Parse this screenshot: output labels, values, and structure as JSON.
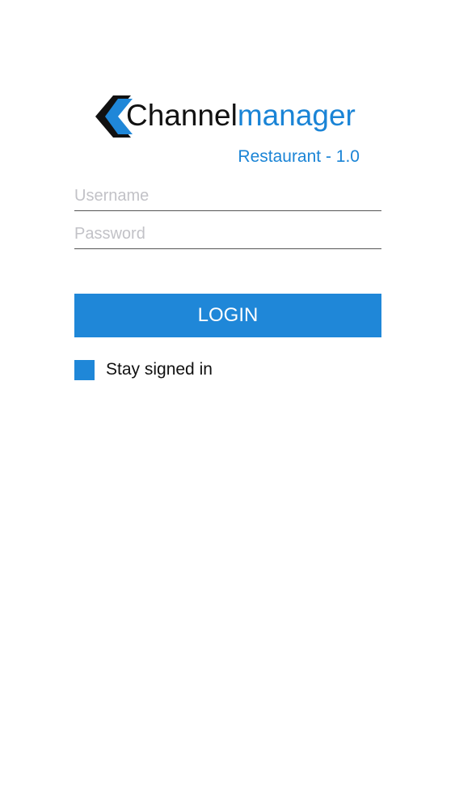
{
  "app": {
    "logo_text_part1": "Channel",
    "logo_text_part2": "manager",
    "subtitle": "Restaurant - 1.0"
  },
  "form": {
    "username_placeholder": "Username",
    "username_value": "",
    "password_placeholder": "Password",
    "password_value": "",
    "login_label": "LOGIN",
    "stay_signed_in_label": "Stay signed in",
    "stay_signed_in_checked": true
  },
  "colors": {
    "brand_blue": "#1f87d8",
    "logo_dark": "#111111",
    "background": "#ffffff"
  },
  "icons": {
    "logo_mark": "channelmanager-logo-icon"
  }
}
